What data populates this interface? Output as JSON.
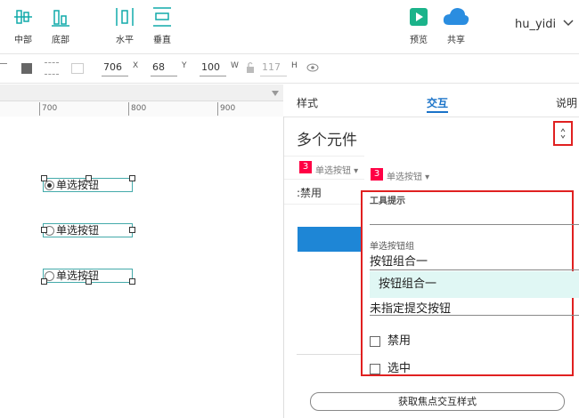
{
  "toolbar": {
    "buttons": [
      {
        "label": "中部"
      },
      {
        "label": "底部"
      },
      {
        "label": "水平"
      },
      {
        "label": "垂直"
      },
      {
        "label": "预览"
      },
      {
        "label": "共享"
      }
    ],
    "user": "hu_yidi"
  },
  "props": {
    "x": "706",
    "x_unit": "X",
    "y": "68",
    "y_unit": "Y",
    "w": "100",
    "w_unit": "W",
    "h": "117",
    "h_unit": "H"
  },
  "ruler": {
    "ticks": [
      "700",
      "800",
      "900"
    ]
  },
  "canvas": {
    "widgets": [
      {
        "label": "单选按钮",
        "checked": true
      },
      {
        "label": "单选按钮",
        "checked": false
      },
      {
        "label": "单选按钮",
        "checked": false
      }
    ]
  },
  "panel": {
    "tabs": [
      "样式",
      "交互",
      "说明"
    ],
    "title": "多个元件",
    "badge_count": "3",
    "badge_label": "单选按钮 ▾",
    "disabled_label": ":禁用",
    "footer_button": "获取焦点交互样式"
  },
  "dropdown": {
    "badge_count": "3",
    "badge_label": "单选按钮 ▾",
    "tooltip_label": "工具提示",
    "group_label": "单选按钮组",
    "group_value": "按钮组合一",
    "highlight_option": "按钮组合一",
    "submit_value": "未指定提交按钮",
    "check_disable": "禁用",
    "check_select": "选中"
  },
  "colors": {
    "accent": "#1a73c8",
    "highlight": "#e02020",
    "badge": "#ff0044"
  }
}
